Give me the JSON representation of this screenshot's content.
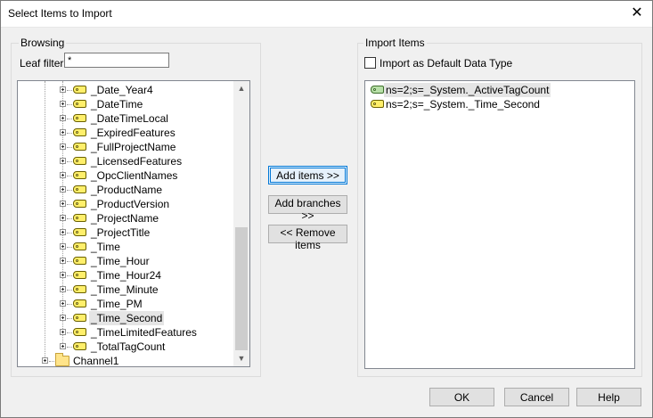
{
  "window": {
    "title": "Select Items to Import",
    "close_glyph": "✕"
  },
  "browsing": {
    "group_label": "Browsing",
    "leaf_filter_label": "Leaf filter:",
    "leaf_filter_value": "*",
    "tree_items": [
      "_Date_Year4",
      "_DateTime",
      "_DateTimeLocal",
      "_ExpiredFeatures",
      "_FullProjectName",
      "_LicensedFeatures",
      "_OpcClientNames",
      "_ProductName",
      "_ProductVersion",
      "_ProjectName",
      "_ProjectTitle",
      "_Time",
      "_Time_Hour",
      "_Time_Hour24",
      "_Time_Minute",
      "_Time_PM",
      "_Time_Second",
      "_TimeLimitedFeatures",
      "_TotalTagCount"
    ],
    "selected_item": "_Time_Second",
    "folder_item": "Channel1",
    "scroll_up_glyph": "▲",
    "scroll_down_glyph": "▼"
  },
  "actions": {
    "add_items": "Add items >>",
    "add_branches": "Add branches >>",
    "remove_items": "<< Remove items"
  },
  "import_items": {
    "group_label": "Import Items",
    "default_type_label": "Import as Default Data Type",
    "default_type_checked": false,
    "items": [
      {
        "label": "ns=2;s=_System._ActiveTagCount",
        "icon": "tag-array-icon"
      },
      {
        "label": "ns=2;s=_System._Time_Second",
        "icon": "tag-icon"
      }
    ]
  },
  "footer": {
    "ok": "OK",
    "cancel": "Cancel",
    "help": "Help"
  }
}
